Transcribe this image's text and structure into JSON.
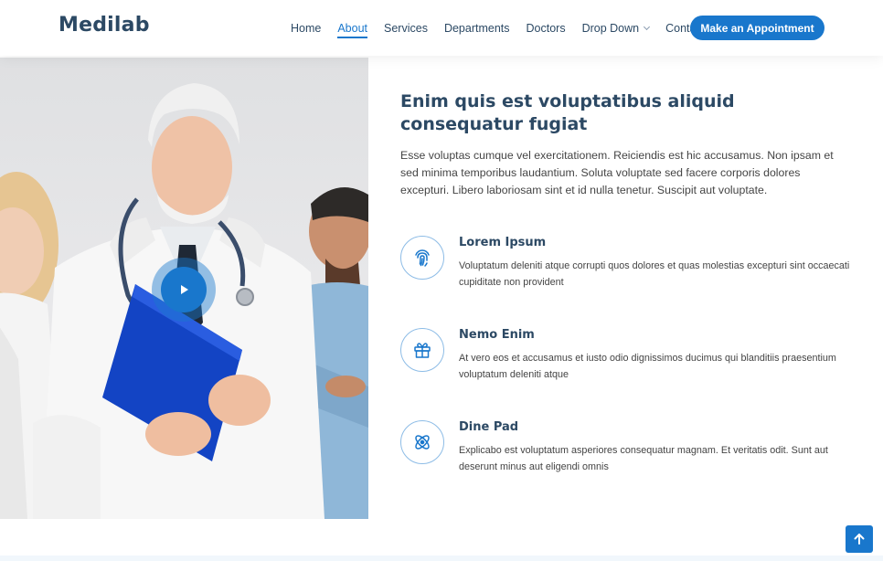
{
  "header": {
    "logo": "Medilab",
    "nav": [
      {
        "label": "Home",
        "active": false
      },
      {
        "label": "About",
        "active": true
      },
      {
        "label": "Services",
        "active": false
      },
      {
        "label": "Departments",
        "active": false
      },
      {
        "label": "Doctors",
        "active": false
      },
      {
        "label": "Drop Down",
        "active": false,
        "has_dropdown": true
      },
      {
        "label": "Contact",
        "active": false
      }
    ],
    "cta_label": "Make an Appointment"
  },
  "about": {
    "image_alt_icon": "play-icon",
    "title": "Enim quis est voluptatibus aliquid consequatur fugiat",
    "intro": "Esse voluptas cumque vel exercitationem. Reiciendis est hic accusamus. Non ipsam et sed minima temporibus laudantium. Soluta voluptate sed facere corporis dolores excepturi. Libero laboriosam sint et id nulla tenetur. Suscipit aut voluptate.",
    "features": [
      {
        "icon": "fingerprint-icon",
        "title": "Lorem Ipsum",
        "desc": "Voluptatum deleniti atque corrupti quos dolores et quas molestias excepturi sint occaecati cupiditate non provident"
      },
      {
        "icon": "gift-icon",
        "title": "Nemo Enim",
        "desc": "At vero eos et accusamus et iusto odio dignissimos ducimus qui blanditiis praesentium voluptatum deleniti atque"
      },
      {
        "icon": "atom-icon",
        "title": "Dine Pad",
        "desc": "Explicabo est voluptatum asperiores consequatur magnam. Et veritatis odit. Sunt aut deserunt minus aut eligendi omnis"
      }
    ]
  },
  "colors": {
    "accent": "#1977cc",
    "heading": "#2c4964",
    "text": "#444444"
  },
  "scroll_top_icon": "arrow-up-icon"
}
